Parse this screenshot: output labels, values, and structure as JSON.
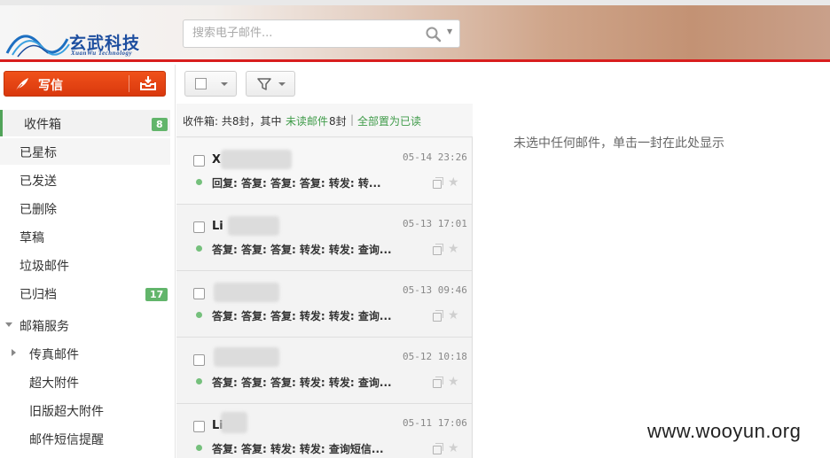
{
  "header": {
    "logo_text": "玄武科技",
    "logo_subtitle": "XuanWu Technology",
    "search_placeholder": "搜索电子邮件..."
  },
  "compose": {
    "label": "写信"
  },
  "toolbar": {
    "select_icon": "checkbox-icon",
    "filter_icon": "filter-icon"
  },
  "sidebar": {
    "folders": [
      {
        "label": "收件箱",
        "badge": "8"
      },
      {
        "label": "已星标"
      },
      {
        "label": "已发送"
      },
      {
        "label": "已删除"
      },
      {
        "label": "草稿"
      },
      {
        "label": "垃圾邮件"
      },
      {
        "label": "已归档",
        "badge": "17"
      }
    ],
    "services": {
      "label": "邮箱服务",
      "items": [
        {
          "label": "传真邮件"
        },
        {
          "label": "超大附件"
        },
        {
          "label": "旧版超大附件"
        },
        {
          "label": "邮件短信提醒"
        }
      ]
    }
  },
  "list_header": {
    "prefix": "收件箱: 共8封，其中",
    "unread_link": "未读邮件",
    "count_suffix": "8封",
    "separator": "|",
    "mark_all": "全部置为已读"
  },
  "mails": [
    {
      "sender": "X",
      "time": "05-14 23:26",
      "subject": "回复: 答复: 答复: 答复: 转发: 转..."
    },
    {
      "sender": "Li",
      "time": "05-13 17:01",
      "subject": "答复: 答复: 答复: 转发: 转发: 查询..."
    },
    {
      "sender": "",
      "time": "05-13 09:46",
      "subject": "答复: 答复: 答复: 转发: 转发: 查询..."
    },
    {
      "sender": "",
      "time": "05-12 10:18",
      "subject": "答复: 答复: 答复: 转发: 转发: 查询..."
    },
    {
      "sender": "Li",
      "time": "05-11 17:06",
      "subject": "答复: 答复: 转发: 转发: 查询短信..."
    }
  ],
  "reading_pane": {
    "empty_message": "未选中任何邮件，单击一封在此处显示"
  },
  "watermark": "www.wooyun.org",
  "colors": {
    "accent_red": "#d81e1e",
    "compose_orange": "#e8461a",
    "badge_green": "#62b56b",
    "link_green": "#3f9b49"
  }
}
